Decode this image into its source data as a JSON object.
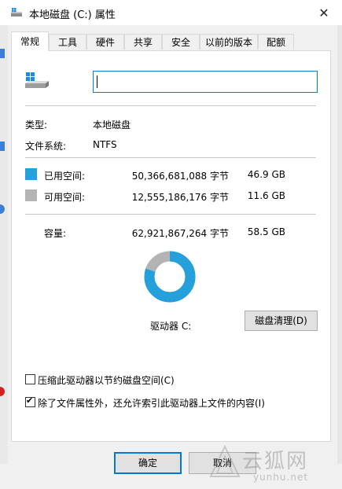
{
  "window": {
    "title": "本地磁盘 (C:) 属性",
    "close_glyph": "✕"
  },
  "tabs": [
    {
      "label": "常规",
      "active": true
    },
    {
      "label": "工具"
    },
    {
      "label": "硬件"
    },
    {
      "label": "共享"
    },
    {
      "label": "安全"
    },
    {
      "label": "以前的版本"
    },
    {
      "label": "配额"
    }
  ],
  "general": {
    "name_value": "",
    "type_label": "类型:",
    "type_value": "本地磁盘",
    "fs_label": "文件系统:",
    "fs_value": "NTFS",
    "used": {
      "label": "已用空间:",
      "bytes": "50,366,681,088 字节",
      "size": "46.9 GB",
      "color": "#26a0da"
    },
    "free": {
      "label": "可用空间:",
      "bytes": "12,555,186,176 字节",
      "size": "11.6 GB",
      "color": "#b4b4b4"
    },
    "capacity": {
      "label": "容量:",
      "bytes": "62,921,867,264 字节",
      "size": "58.5 GB"
    },
    "used_fraction": 0.8005,
    "drive_label": "驱动器 C:",
    "cleanup_button": "磁盘清理(D)",
    "compress_label": "压缩此驱动器以节约磁盘空间(C)",
    "compress_checked": false,
    "index_label": "除了文件属性外，还允许索引此驱动器上文件的内容(I)",
    "index_checked": true
  },
  "footer": {
    "ok_label": "确定",
    "cancel_label": "取消"
  },
  "watermark": {
    "text": "云狐网",
    "sub": "yunhu.net"
  },
  "icons": [
    "drive-icon",
    "windows-logo-icon",
    "close-icon",
    "checkmark-icon"
  ]
}
